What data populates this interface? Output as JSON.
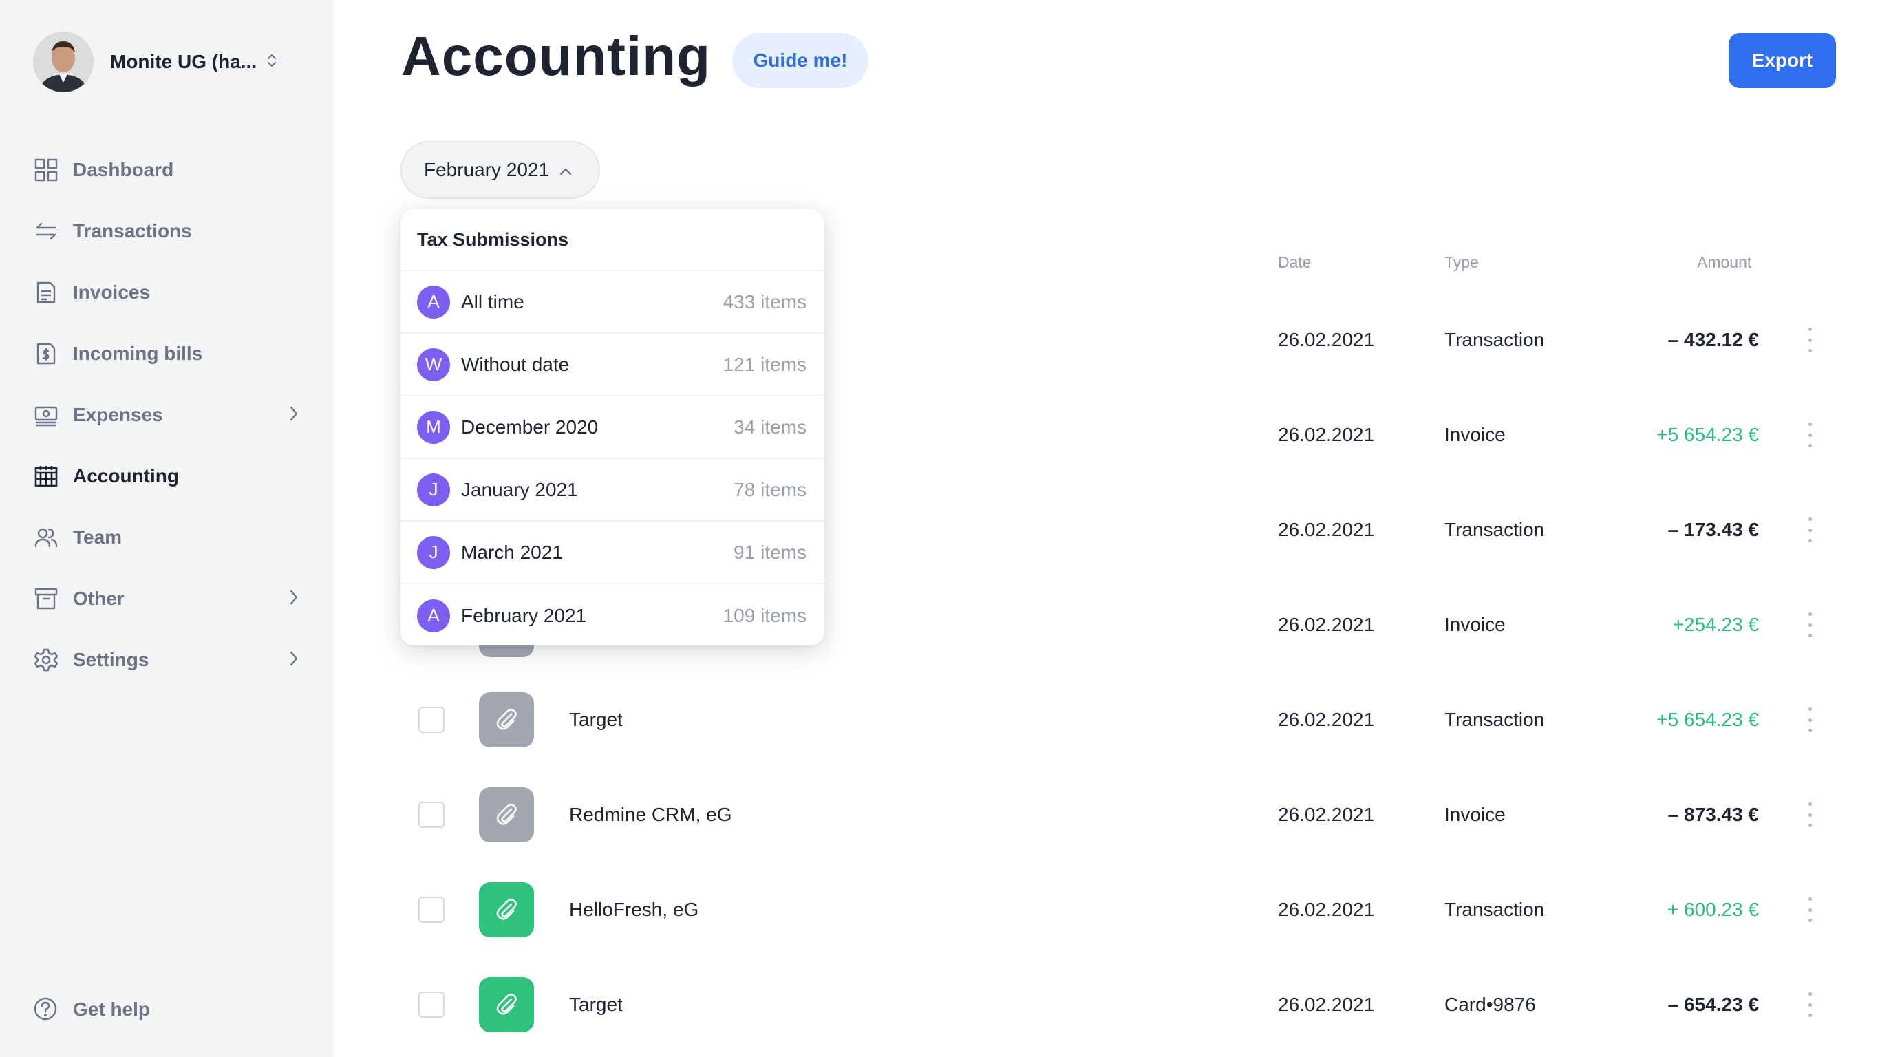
{
  "org": {
    "name": "Monite UG (ha..."
  },
  "page": {
    "title": "Accounting",
    "guide_label": "Guide me!",
    "export_label": "Export"
  },
  "sidebar": {
    "items": [
      {
        "label": "Dashboard",
        "icon": "grid-icon",
        "has_arrow": false
      },
      {
        "label": "Transactions",
        "icon": "arrows-icon",
        "has_arrow": false
      },
      {
        "label": "Invoices",
        "icon": "invoice-icon",
        "has_arrow": false
      },
      {
        "label": "Incoming bills",
        "icon": "bill-icon",
        "has_arrow": false
      },
      {
        "label": "Expenses",
        "icon": "money-icon",
        "has_arrow": true
      },
      {
        "label": "Accounting",
        "icon": "calendar-grid-icon",
        "has_arrow": false,
        "active": true
      },
      {
        "label": "Team",
        "icon": "team-icon",
        "has_arrow": false
      },
      {
        "label": "Other",
        "icon": "archive-icon",
        "has_arrow": true
      },
      {
        "label": "Settings",
        "icon": "gear-icon",
        "has_arrow": true
      }
    ],
    "help_label": "Get help"
  },
  "period": {
    "selected": "February 2021"
  },
  "table": {
    "headers": {
      "date": "Date",
      "type": "Type",
      "amount": "Amount"
    },
    "rows": [
      {
        "name": "",
        "date": "26.02.2021",
        "type": "Transaction",
        "amount": "– 432.12 €",
        "positive": false
      },
      {
        "name": "",
        "date": "26.02.2021",
        "type": "Invoice",
        "amount": "+5 654.23 €",
        "positive": true
      },
      {
        "name": "",
        "date": "26.02.2021",
        "type": "Transaction",
        "amount": "– 173.43 €",
        "positive": false
      },
      {
        "name": "",
        "date": "26.02.2021",
        "type": "Invoice",
        "amount": "+254.23 €",
        "positive": true
      },
      {
        "name": "Target",
        "date": "26.02.2021",
        "type": "Transaction",
        "amount": "+5 654.23 €",
        "positive": true,
        "clip": "gray"
      },
      {
        "name": "Redmine CRM, eG",
        "date": "26.02.2021",
        "type": "Invoice",
        "amount": "– 873.43 €",
        "positive": false,
        "clip": "gray"
      },
      {
        "name": "HelloFresh, eG",
        "date": "26.02.2021",
        "type": "Transaction",
        "amount": "+ 600.23 €",
        "positive": true,
        "clip": "green"
      },
      {
        "name": "Target",
        "date": "26.02.2021",
        "type": "Card•9876",
        "amount": "– 654.23 €",
        "positive": false,
        "clip": "green"
      }
    ]
  },
  "dropdown": {
    "title": "Tax Submissions",
    "items": [
      {
        "badge": "A",
        "label": "All time",
        "count": "433 items"
      },
      {
        "badge": "W",
        "label": "Without date",
        "count": "121 items"
      },
      {
        "badge": "M",
        "label": "December 2020",
        "count": "34 items"
      },
      {
        "badge": "J",
        "label": "January 2021",
        "count": "78 items"
      },
      {
        "badge": "J",
        "label": "March 2021",
        "count": "91 items"
      },
      {
        "badge": "A",
        "label": "February 2021",
        "count": "109 items"
      }
    ]
  },
  "colors": {
    "accent": "#2f6ff0",
    "positive": "#2bbd7e",
    "badge": "#7b5ff0",
    "sidebar_bg": "#f3f4f6"
  }
}
